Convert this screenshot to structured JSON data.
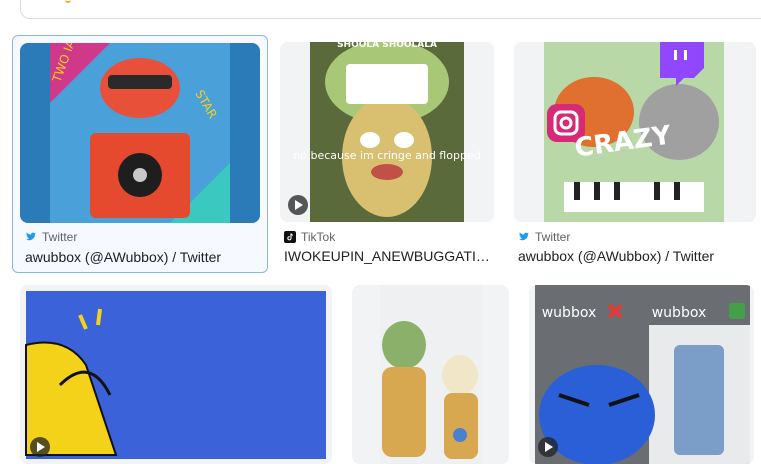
{
  "results": [
    {
      "source": "Twitter",
      "title": "awubbox (@AWubbox) / Twitter"
    },
    {
      "source": "TikTok",
      "title": "IWOKEUPIN_ANEWBUGGATI(clean)...",
      "overlay": [
        "SHOOLA SHOOLALA",
        "no because im cringe and flopped"
      ]
    },
    {
      "source": "Twitter",
      "title": "awubbox (@AWubbox) / Twitter",
      "overlay": [
        "CRAZY"
      ]
    },
    {
      "overlay": []
    },
    {
      "overlay": []
    },
    {
      "overlay": [
        "wubbox",
        "wubbox"
      ]
    }
  ],
  "colors": {
    "twitter": "#1d9bf0",
    "selected_border": "#8ab4f8",
    "twitch": "#9146ff"
  }
}
